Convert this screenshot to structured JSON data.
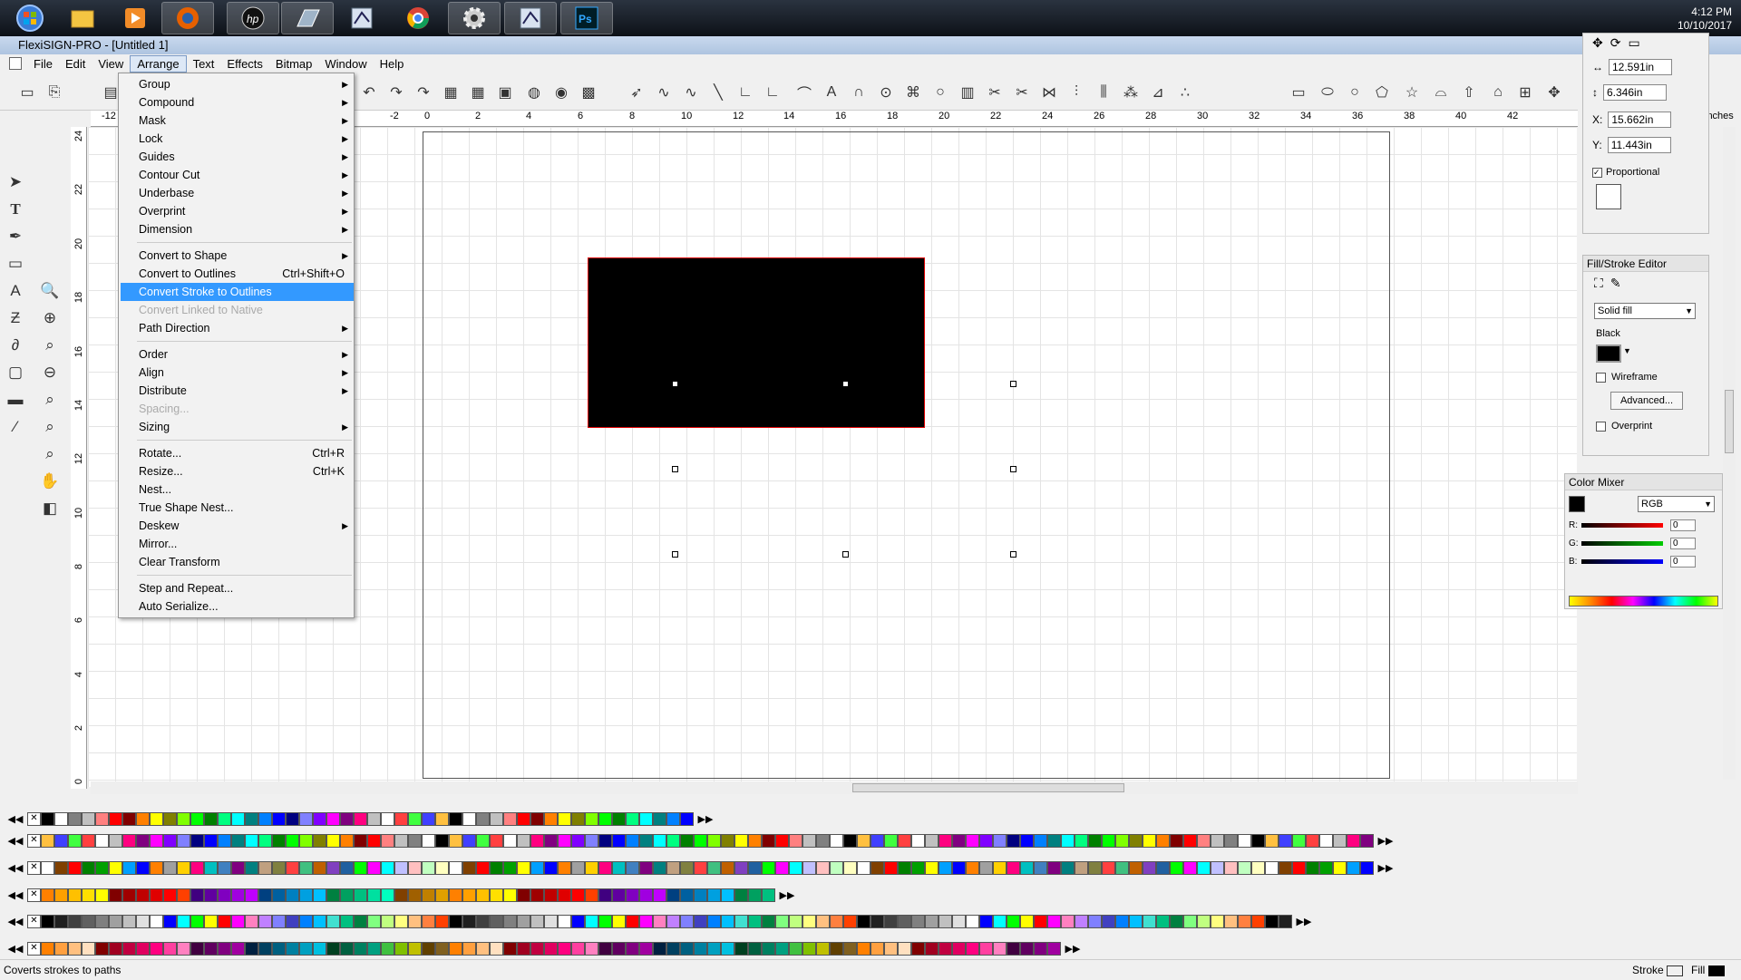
{
  "taskbar": {
    "time": "4:12 PM",
    "date": "10/10/2017",
    "apps": [
      "start-orb",
      "file-explorer",
      "media-player",
      "firefox",
      "hp",
      "app-ghost",
      "flexisign",
      "chrome",
      "settings",
      "flexisign-active",
      "photoshop"
    ]
  },
  "window": {
    "title": "FlexiSIGN-PRO - [Untitled 1]"
  },
  "menubar": [
    "File",
    "Edit",
    "View",
    "Arrange",
    "Text",
    "Effects",
    "Bitmap",
    "Window",
    "Help"
  ],
  "arrange_menu": {
    "items": [
      {
        "label": "Group",
        "submenu": true
      },
      {
        "label": "Compound",
        "submenu": true
      },
      {
        "label": "Mask",
        "submenu": true
      },
      {
        "label": "Lock",
        "submenu": true
      },
      {
        "label": "Guides",
        "submenu": true
      },
      {
        "label": "Contour Cut",
        "submenu": true
      },
      {
        "label": "Underbase",
        "submenu": true
      },
      {
        "label": "Overprint",
        "submenu": true
      },
      {
        "label": "Dimension",
        "submenu": true
      },
      {
        "label": "Convert to Shape",
        "submenu": true
      },
      {
        "label": "Convert to Outlines",
        "shortcut": "Ctrl+Shift+O"
      },
      {
        "label": "Convert Stroke to Outlines",
        "highlighted": true
      },
      {
        "label": "Convert Linked to Native",
        "disabled": true
      },
      {
        "label": "Path Direction",
        "submenu": true
      },
      {
        "label": "Order",
        "submenu": true
      },
      {
        "label": "Align",
        "submenu": true
      },
      {
        "label": "Distribute",
        "submenu": true
      },
      {
        "label": "Spacing...",
        "disabled": true
      },
      {
        "label": "Sizing",
        "submenu": true
      },
      {
        "label": "Rotate...",
        "shortcut": "Ctrl+R"
      },
      {
        "label": "Resize...",
        "shortcut": "Ctrl+K"
      },
      {
        "label": "Nest..."
      },
      {
        "label": "True Shape Nest..."
      },
      {
        "label": "Deskew",
        "submenu": true
      },
      {
        "label": "Mirror..."
      },
      {
        "label": "Clear Transform"
      },
      {
        "label": "Step and Repeat..."
      },
      {
        "label": "Auto Serialize..."
      }
    ]
  },
  "ruler": {
    "h_ticks": [
      "-12",
      "-2",
      "0",
      "2",
      "4",
      "6",
      "8",
      "10",
      "12",
      "14",
      "16",
      "18",
      "20",
      "22",
      "24",
      "26",
      "28",
      "30",
      "32",
      "34",
      "36",
      "38",
      "40",
      "42"
    ],
    "v_ticks": [
      "24",
      "22",
      "20",
      "18",
      "16",
      "14",
      "12",
      "10",
      "8",
      "6",
      "4",
      "2",
      "0"
    ],
    "unit": "inches"
  },
  "properties": {
    "width": "12.591in",
    "height": "6.346in",
    "x_label": "X:",
    "x": "15.662in",
    "y_label": "Y:",
    "y": "11.443in",
    "proportional": "Proportional"
  },
  "fill_stroke": {
    "title": "Fill/Stroke Editor",
    "fill_type": "Solid fill",
    "color_name": "Black",
    "wireframe": "Wireframe",
    "advanced": "Advanced...",
    "overprint": "Overprint"
  },
  "color_mixer": {
    "title": "Color Mixer",
    "model": "RGB",
    "r_label": "R:",
    "r": "0",
    "g_label": "G:",
    "g": "0",
    "b_label": "B:",
    "b": "0"
  },
  "status": {
    "message": "Coverts strokes to paths",
    "stroke_label": "Stroke",
    "fill_label": "Fill"
  },
  "palette_colors": {
    "row1": [
      "#000000",
      "#ffffff",
      "#808080",
      "#c0c0c0",
      "#ff8080",
      "#ff0000",
      "#800000",
      "#ff8000",
      "#ffff00",
      "#808000",
      "#80ff00",
      "#00ff00",
      "#008000",
      "#00ff80",
      "#00ffff",
      "#008080",
      "#0080ff",
      "#0000ff",
      "#000080",
      "#8080ff",
      "#8000ff",
      "#ff00ff",
      "#800080",
      "#ff0080",
      "#c0c0c0",
      "#ffffff",
      "#ff4040",
      "#40ff40",
      "#4040ff",
      "#ffc040"
    ],
    "row3": [
      "#ffffff",
      "#804000",
      "#ff0000",
      "#008000",
      "#00a000",
      "#ffff00",
      "#00a0ff",
      "#0000ff",
      "#ff8000",
      "#a0a0a0",
      "#ffd000",
      "#ff0080",
      "#00c0c0",
      "#4080c0",
      "#800080",
      "#008080",
      "#c0a080",
      "#808040",
      "#ff4040",
      "#40c080",
      "#c06000",
      "#8040c0",
      "#2060a0",
      "#00ff00",
      "#ff00ff",
      "#00ffff",
      "#c0c0ff",
      "#ffc0c0",
      "#c0ffc0",
      "#ffffc0"
    ],
    "row4": [
      "#ff8000",
      "#ffa000",
      "#ffc000",
      "#ffe000",
      "#ffff00",
      "#800000",
      "#a00000",
      "#c00000",
      "#e00000",
      "#ff0000",
      "#ff4000",
      "#400080",
      "#6000a0",
      "#8000c0",
      "#a000e0",
      "#c000ff",
      "#004080",
      "#0060a0",
      "#0080c0",
      "#00a0e0",
      "#00c0ff",
      "#008040",
      "#00a060",
      "#00c080",
      "#00e0a0",
      "#00ffc0",
      "#804000",
      "#a06000",
      "#c08000",
      "#e0a000"
    ],
    "row5": [
      "#000000",
      "#202020",
      "#404040",
      "#606060",
      "#808080",
      "#a0a0a0",
      "#c0c0c0",
      "#e0e0e0",
      "#ffffff",
      "#0000ff",
      "#00ffff",
      "#00ff00",
      "#ffff00",
      "#ff0000",
      "#ff00ff",
      "#ff80c0",
      "#c080ff",
      "#8080ff",
      "#4040c0",
      "#0080ff",
      "#00c0ff",
      "#40e0d0",
      "#00c080",
      "#008040",
      "#80ff80",
      "#c0ff80",
      "#ffff80",
      "#ffc080",
      "#ff8040",
      "#ff4000"
    ],
    "row6": [
      "#ff8000",
      "#ffa040",
      "#ffc080",
      "#ffe0c0",
      "#800000",
      "#a00020",
      "#c00040",
      "#e00060",
      "#ff0080",
      "#ff40a0",
      "#ff80c0",
      "#400040",
      "#600060",
      "#800080",
      "#a000a0",
      "#002040",
      "#004060",
      "#006080",
      "#0080a0",
      "#00a0c0",
      "#00c0e0",
      "#004020",
      "#006040",
      "#008060",
      "#00a080",
      "#40c040",
      "#80c000",
      "#c0c000",
      "#604000",
      "#806020"
    ]
  }
}
